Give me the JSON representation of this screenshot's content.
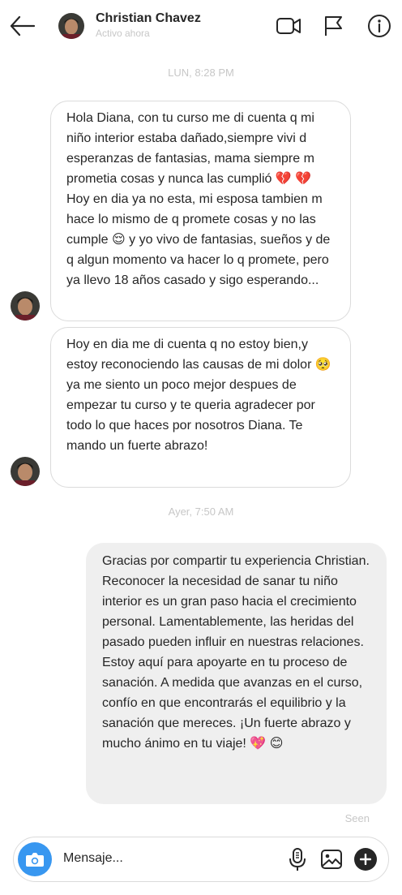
{
  "header": {
    "name": "Christian Chavez",
    "status": "Activo ahora"
  },
  "messages": {
    "timestamp1": "LUN, 8:28 PM",
    "timestamp2": "Ayer, 7:50 AM",
    "msg1_part1": "Hola Diana, con tu curso me di cuenta q mi niño interior estaba dañado,siempre vivi d esperanzas de fantasias, mama siempre m prometia cosas y nunca las cumplió",
    "msg1_part2": "Hoy en dia ya no esta, mi esposa tambien m hace lo mismo de q promete cosas y no las cumple",
    "msg1_part3": "y yo vivo de fantasias, sueños y de q algun momento va hacer lo q promete, pero ya llevo 18 años casado y sigo esperando...",
    "msg2_part1": "Hoy en dia me di cuenta q no estoy bien,y estoy reconociendo las causas de mi dolor",
    "msg2_part2": "ya me siento un poco mejor despues de empezar tu curso y te queria agradecer por todo lo que haces por nosotros Diana. Te mando un fuerte abrazo!",
    "msg3": "Gracias por compartir tu experiencia Christian. Reconocer la necesidad de sanar tu niño interior es un gran paso hacia el crecimiento personal. Lamentablemente, las heridas del pasado pueden influir en nuestras relaciones. Estoy aquí para apoyarte en tu proceso de sanación. A medida que avanzas en el curso, confío en que encontrarás el equilibrio y la sanación que mereces. ¡Un fuerte abrazo y mucho ánimo en tu viaje!",
    "seen": "Seen"
  },
  "emoji": {
    "broken_heart": "💔",
    "relieved": "😌",
    "pleading": "🥺",
    "sparkling_heart": "💖",
    "smile": "😊"
  },
  "composer": {
    "placeholder": "Mensaje..."
  },
  "icons": {
    "back": "back-arrow-icon",
    "video": "video-call-icon",
    "flag": "flag-icon",
    "info": "info-icon",
    "camera": "camera-icon",
    "mic": "microphone-icon",
    "image": "image-icon",
    "plus": "plus-icon"
  },
  "colors": {
    "accent": "#3897f0",
    "text": "#262626",
    "muted": "#c7c7c7",
    "bubble_out": "#efefef",
    "border": "#dbdbdb"
  }
}
